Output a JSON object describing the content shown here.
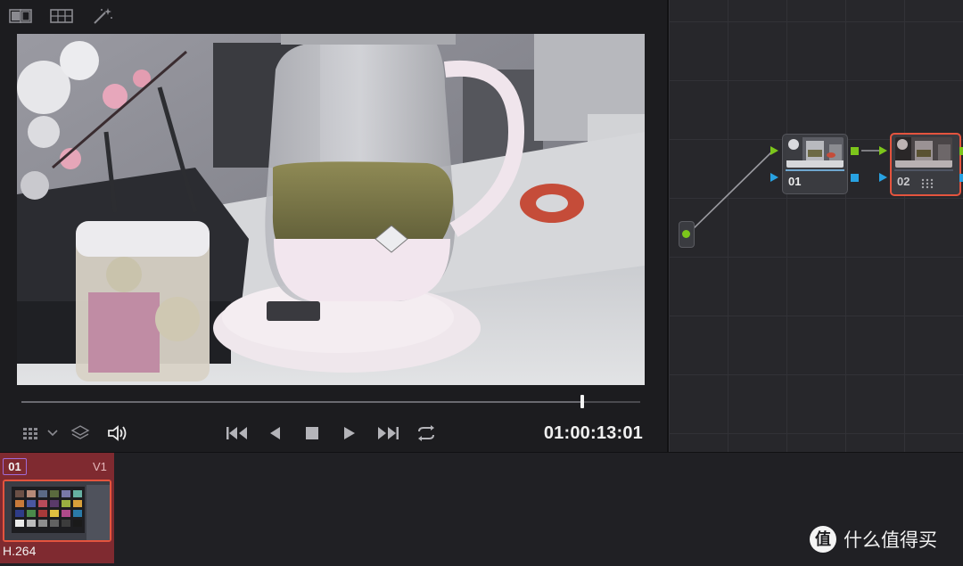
{
  "viewer": {
    "toolbar": {
      "icons": [
        "compare-split-icon",
        "gallery-grid-icon",
        "magic-wand-icon"
      ]
    },
    "frame_description": "",
    "playhead_progress": 0.907,
    "transport": {
      "icons": [
        "jump-to-start-icon",
        "step-back-icon",
        "stop-icon",
        "play-icon",
        "jump-to-end-icon",
        "loop-icon"
      ]
    },
    "left_controls": {
      "icons": [
        "viewer-mode-grid-icon",
        "chevron-down-icon",
        "layers-icon",
        "speaker-icon"
      ]
    },
    "timecode": "01:00:13:01"
  },
  "node_graph": {
    "nodes": [
      {
        "label": "01"
      },
      {
        "label": "02"
      }
    ]
  },
  "timeline": {
    "clip": {
      "number": "01",
      "track": "V1",
      "codec": "H.264"
    }
  },
  "watermark": {
    "icon_glyph": "值",
    "text": "什么值得买"
  },
  "colors": {
    "accent_green": "#7cc51b",
    "accent_blue": "#28a2e2",
    "selected_node_border": "#e4543e",
    "clip_background": "#7f2a30"
  }
}
